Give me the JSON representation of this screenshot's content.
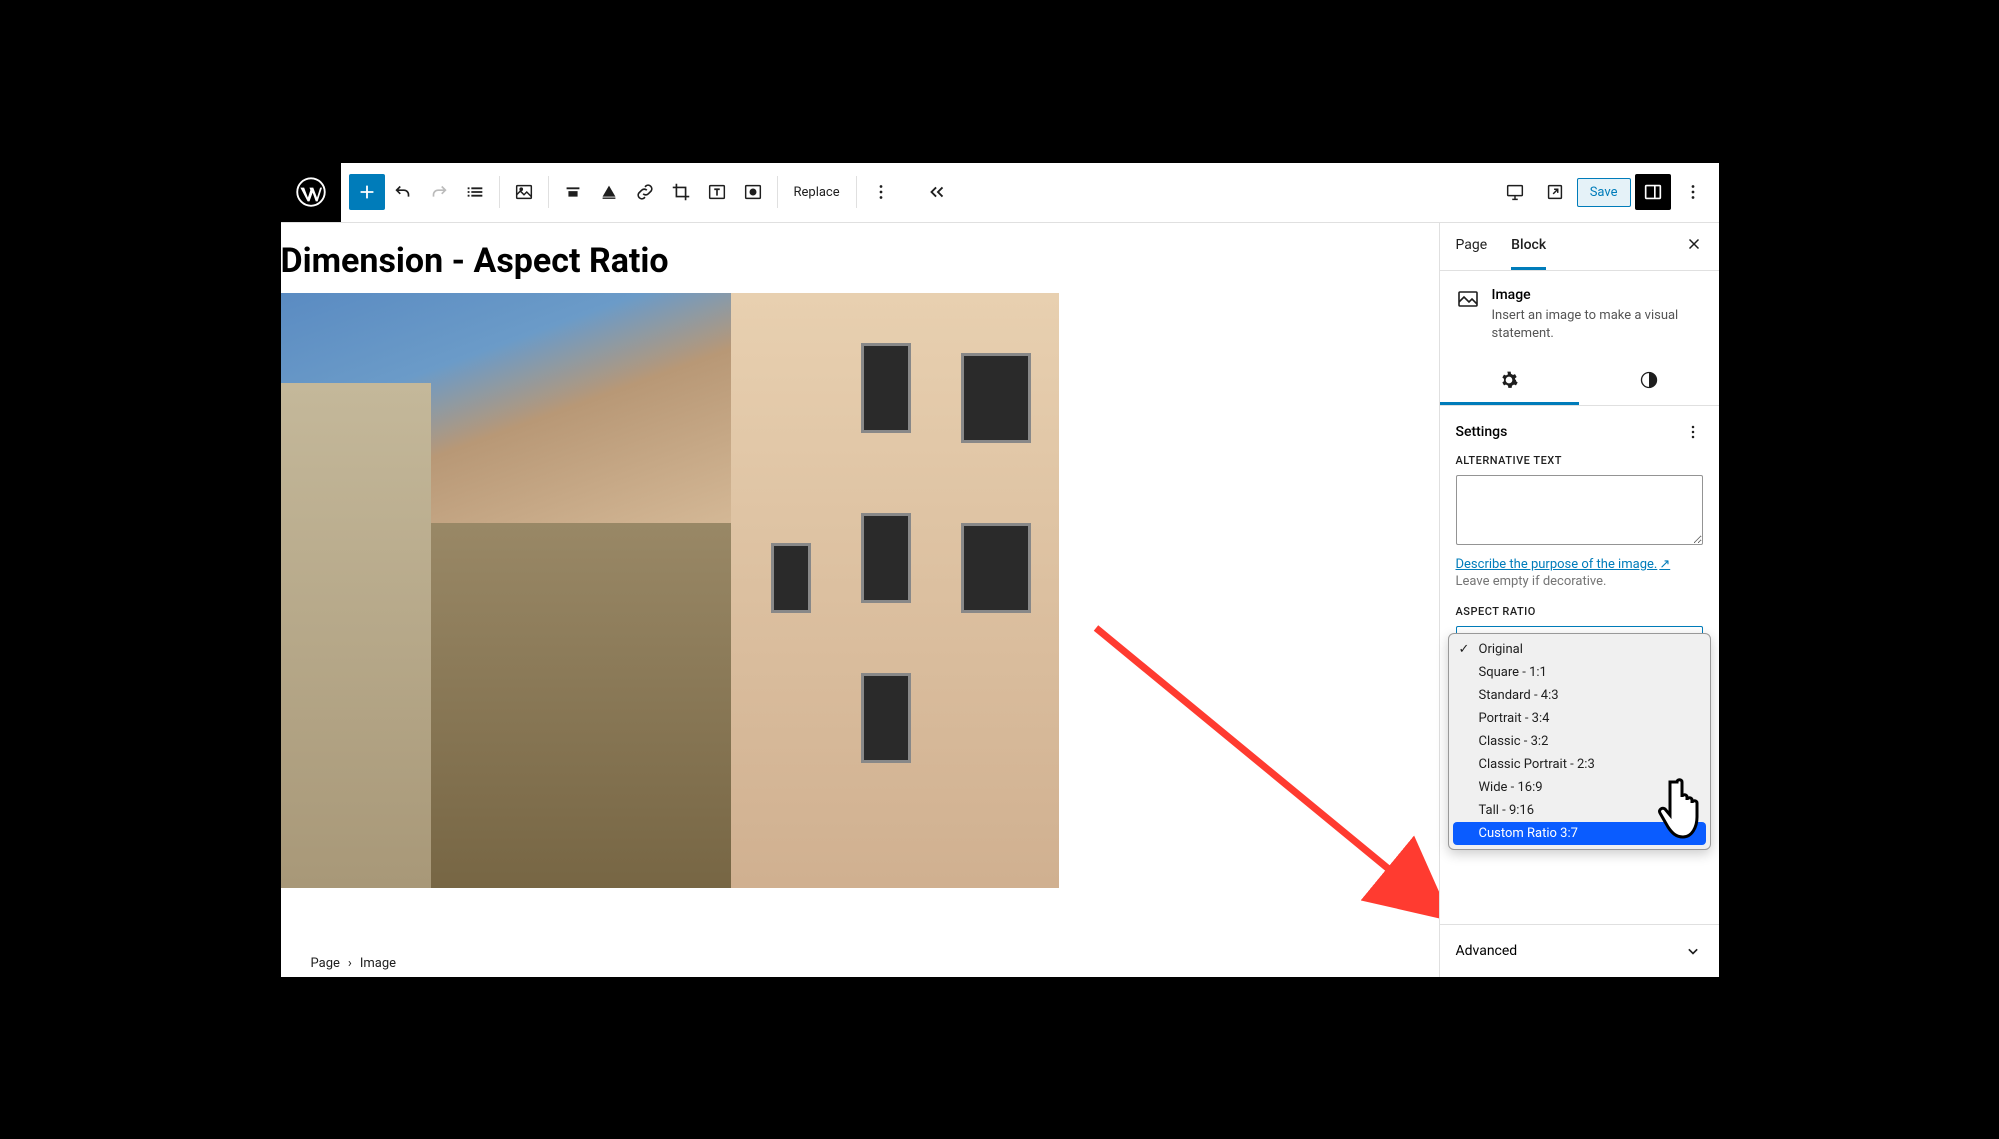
{
  "toolbar": {
    "replace_label": "Replace",
    "save_label": "Save"
  },
  "canvas": {
    "title": "Dimension - Aspect Ratio"
  },
  "breadcrumb": {
    "parent": "Page",
    "current": "Image"
  },
  "sidebar": {
    "tabs": {
      "page": "Page",
      "block": "Block"
    },
    "block_name": "Image",
    "block_desc": "Insert an image to make a visual statement.",
    "settings_label": "Settings",
    "alt_label": "ALTERNATIVE TEXT",
    "alt_help_link": "Describe the purpose of the image.",
    "alt_help_text": "Leave empty if decorative.",
    "aspect_label": "ASPECT RATIO",
    "aspect_options": [
      "Original",
      "Square - 1:1",
      "Standard - 4:3",
      "Portrait - 3:4",
      "Classic - 3:2",
      "Classic Portrait - 2:3",
      "Wide - 16:9",
      "Tall - 9:16",
      "Custom Ratio 3:7"
    ],
    "aspect_checked_index": 0,
    "aspect_highlighted_index": 8,
    "advanced_label": "Advanced"
  }
}
